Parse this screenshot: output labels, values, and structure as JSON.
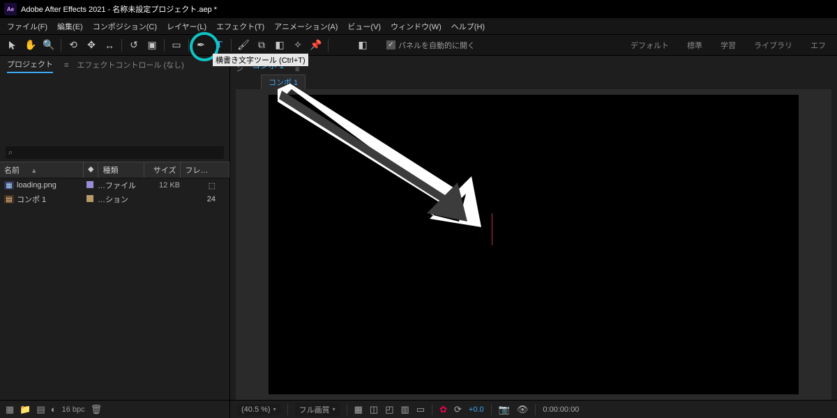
{
  "title": "Adobe After Effects 2021 - 名称未設定プロジェクト.aep *",
  "menu": [
    "ファイル(F)",
    "編集(E)",
    "コンポジション(C)",
    "レイヤー(L)",
    "エフェクト(T)",
    "アニメーション(A)",
    "ビュー(V)",
    "ウィンドウ(W)",
    "ヘルプ(H)"
  ],
  "tooltip": "横書き文字ツール (Ctrl+T)",
  "autoOpen": "パネルを自動的に開く",
  "workspaces": [
    "デフォルト",
    "標準",
    "学習",
    "ライブラリ",
    "エフ"
  ],
  "panel": {
    "project": "プロジェクト",
    "projectMenu": "≡",
    "effectControls": "エフェクトコントロール (なし)"
  },
  "search": {
    "placeholder": ""
  },
  "cols": {
    "name": "名前",
    "tag": "◆",
    "type": "種類",
    "size": "サイズ",
    "fr": "フレ…"
  },
  "items": [
    {
      "icon": "img",
      "swatch": "#9a8bd4",
      "name": "loading.png",
      "type": "…ファイル",
      "size": "12 KB",
      "fr": ""
    },
    {
      "icon": "comp",
      "swatch": "#b79b6a",
      "name": "コンポ 1",
      "type": "…ション",
      "size": "",
      "fr": "24"
    }
  ],
  "leftFooter": {
    "bpc": "16 bpc"
  },
  "compTabs": {
    "hidden": "ン",
    "name": "コンポ 1",
    "inner": "コンポ 1"
  },
  "viewerFooter": {
    "zoom": "(40.5 %)",
    "quality": "フル画質",
    "exposure": "+0.0",
    "timecode": "0:00:00:00"
  }
}
